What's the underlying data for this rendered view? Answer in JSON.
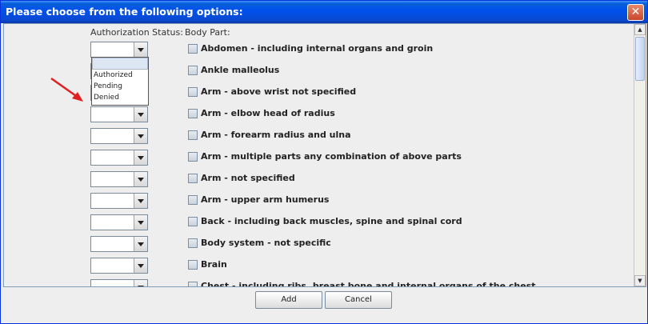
{
  "dialog": {
    "title": "Please choose from the following options:",
    "close_glyph": "✕"
  },
  "headers": {
    "authorization_status": "Authorization Status:",
    "body_part": "Body Part:"
  },
  "dropdown": {
    "options": [
      "",
      "Authorized",
      "Pending",
      "Denied"
    ]
  },
  "body_parts": [
    "Abdomen - including internal organs and groin",
    "Ankle malleolus",
    "Arm - above wrist not specified",
    "Arm - elbow head of radius",
    "Arm - forearm radius and ulna",
    "Arm - multiple parts any combination of above parts",
    "Arm - not specified",
    "Arm - upper arm humerus",
    "Back - including back muscles, spine and spinal cord",
    "Body system - not specific",
    "Brain",
    "Chest - including ribs, breast bone and internal organs of the chest"
  ],
  "buttons": {
    "add": "Add",
    "cancel": "Cancel"
  },
  "colors": {
    "titlebar": "#0050ee",
    "annotation_arrow": "#e02020"
  }
}
